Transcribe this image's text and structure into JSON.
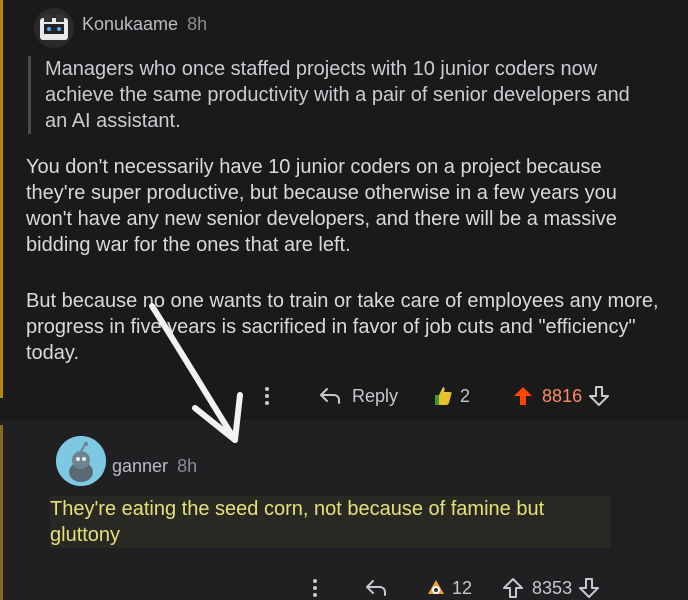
{
  "op": {
    "author": "Konukaame",
    "time": "8h",
    "quote": "Managers who once staffed projects with 10 junior coders now achieve the same productivity with a pair of senior developers and an AI assistant.",
    "paragraph1": "You don't necessarily have 10 junior coders on a project because they're super productive, but because otherwise in a few years you won't have any new senior developers, and there will be a massive bidding war for the ones that are left.",
    "paragraph2": "But because no one wants to train or take care of employees any more, progress in five years is sacrificed in favor of job cuts and \"efficiency\" today.",
    "actions": {
      "reply_label": "Reply",
      "award_count": "2",
      "score": "8816"
    }
  },
  "reply": {
    "author": "ganner",
    "time": "8h",
    "text": "They're eating the seed corn, not because of famine but gluttony",
    "actions": {
      "award_count": "12",
      "score": "8353"
    }
  },
  "colors": {
    "background": "#1a1a1b",
    "thread_line": "#b8860b",
    "upvote_active": "#ff4500",
    "highlight_text": "#e6e07a"
  }
}
